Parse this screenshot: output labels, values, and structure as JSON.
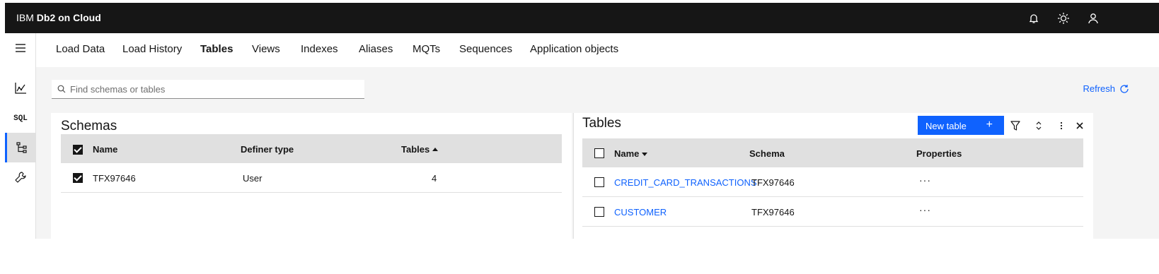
{
  "header": {
    "brand_prefix": "IBM ",
    "brand_name": "Db2 on Cloud"
  },
  "top_icons": [
    "notification-icon",
    "theme-sun-icon",
    "user-profile-icon"
  ],
  "sidenav": {
    "items": [
      "menu-icon",
      "monitor-chart-icon",
      "SQL",
      "schema-tree-icon",
      "admin-wrench-icon"
    ],
    "sql_label": "SQL"
  },
  "tabs": [
    "Load Data",
    "Load History",
    "Tables",
    "Views",
    "Indexes",
    "Aliases",
    "MQTs",
    "Sequences",
    "Application objects"
  ],
  "active_tab": "Tables",
  "search": {
    "placeholder": "Find schemas or tables",
    "value": ""
  },
  "refresh_label": "Refresh",
  "schemas": {
    "title": "Schemas",
    "columns": [
      "Name",
      "Definer type",
      "Tables"
    ],
    "rows": [
      {
        "name": "TFX97646",
        "definer_type": "User",
        "tables": "4",
        "checked": true
      }
    ]
  },
  "tables": {
    "title": "Tables",
    "new_table_label": "New table",
    "new_table_plus": "+",
    "columns": [
      "Name",
      "Schema",
      "Properties"
    ],
    "rows": [
      {
        "name": "CREDIT_CARD_TRANSACTIONS",
        "schema": "TFX97646",
        "properties": "···"
      },
      {
        "name": "CUSTOMER",
        "schema": "TFX97646",
        "properties": "···"
      }
    ]
  },
  "colors": {
    "topbar": "#161616",
    "accent": "#0f62fe",
    "background": "#f4f4f4",
    "table_header": "#e0e0e0"
  }
}
